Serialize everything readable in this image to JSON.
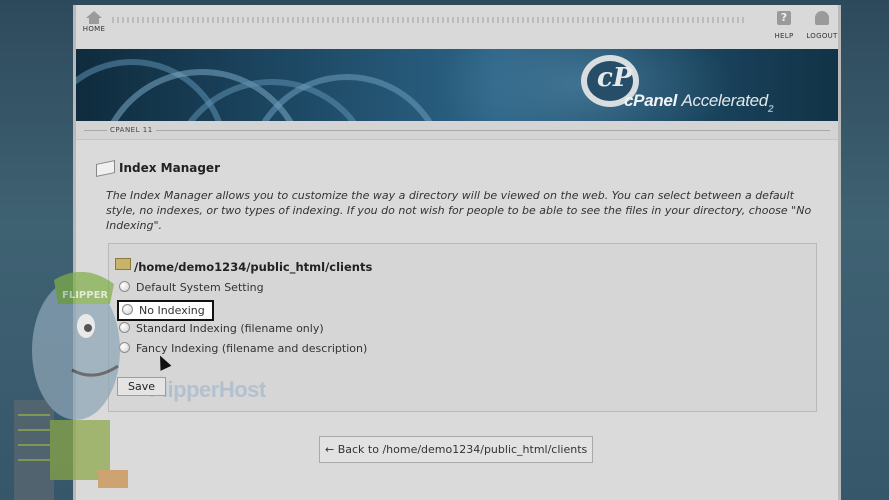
{
  "nav": {
    "home_label": "HOME",
    "help_label": "HELP",
    "logout_label": "LOGOUT"
  },
  "banner": {
    "logo_c": "cP",
    "brand": "cPanel",
    "product": "Accelerated",
    "version": "2"
  },
  "strip": {
    "label": "CPANEL 11"
  },
  "page": {
    "title": "Index Manager",
    "description": "The Index Manager allows you to customize the way a directory will be viewed on the web. You can select between a default style, no indexes, or two types of indexing. If you do not wish for people to be able to see the files in your directory, choose \"No Indexing\"."
  },
  "form": {
    "path": "/home/demo1234/public_html/clients",
    "options": [
      {
        "label": "Default System Setting",
        "selected": false
      },
      {
        "label": "No Indexing",
        "selected": false,
        "highlighted": true
      },
      {
        "label": "Standard Indexing (filename only)",
        "selected": false
      },
      {
        "label": "Fancy Indexing (filename and description)",
        "selected": false
      }
    ],
    "save_label": "Save"
  },
  "back_link": {
    "label": "← Back to /home/demo1234/public_html/clients"
  },
  "watermark": {
    "text": "FlipperHost"
  },
  "mascot": {
    "cap_text": "FLIPPER"
  },
  "icons": {
    "home": "home-icon",
    "help": "help-icon",
    "logout": "logout-icon",
    "title": "index-manager-icon",
    "folder": "folder-icon",
    "cursor": "mouse-cursor-icon"
  },
  "colors": {
    "banner_dark": "#0f2b3d",
    "banner_mid": "#2c6385",
    "page_bg": "#dadada",
    "highlight_border": "#111111"
  }
}
